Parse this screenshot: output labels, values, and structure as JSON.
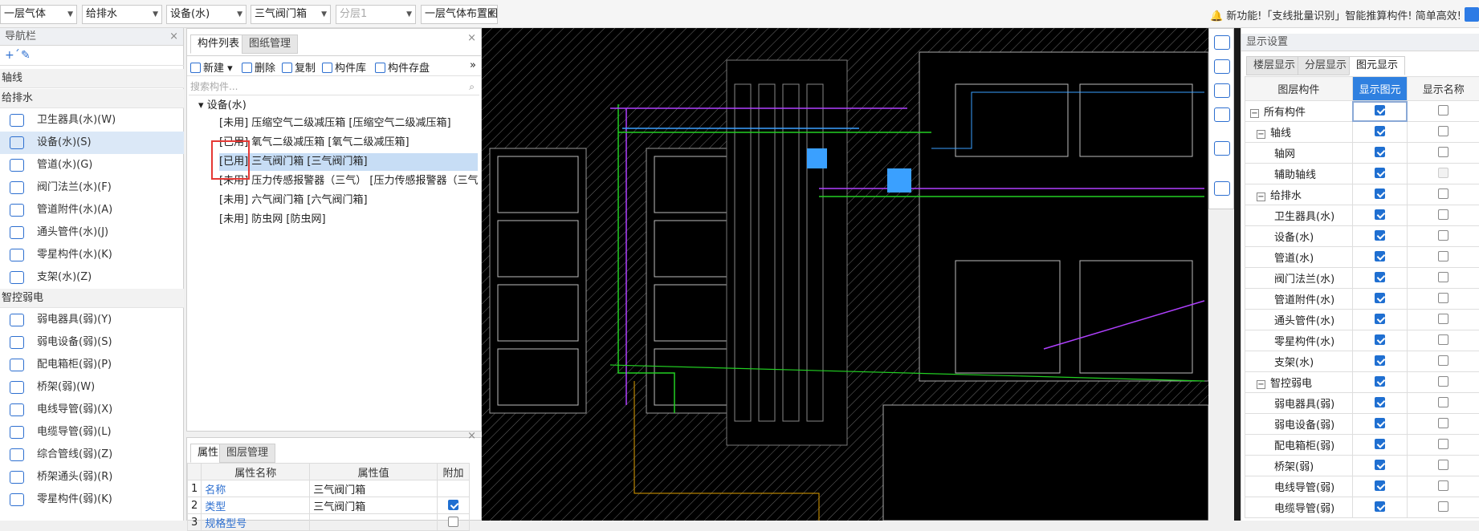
{
  "topbar": {
    "dropdowns": [
      "一层气体",
      "给排水",
      "设备(水)",
      "三气阀门箱",
      "分层1",
      "一层气体布置图"
    ],
    "notice_text": "新功能!「支线批量识别」智能推算构件! 简单高效!"
  },
  "nav": {
    "title": "导航栏",
    "groups": [
      {
        "label": "轴线",
        "items": []
      },
      {
        "label": "给排水",
        "items": [
          "卫生器具(水)(W)",
          "设备(水)(S)",
          "管道(水)(G)",
          "阀门法兰(水)(F)",
          "管道附件(水)(A)",
          "通头管件(水)(J)",
          "零星构件(水)(K)",
          "支架(水)(Z)"
        ]
      },
      {
        "label": "智控弱电",
        "items": [
          "弱电器具(弱)(Y)",
          "弱电设备(弱)(S)",
          "配电箱柜(弱)(P)",
          "桥架(弱)(W)",
          "电线导管(弱)(X)",
          "电缆导管(弱)(L)",
          "综合管线(弱)(Z)",
          "桥架通头(弱)(R)",
          "零星构件(弱)(K)"
        ]
      }
    ],
    "selected": "设备(水)(S)"
  },
  "components": {
    "tabs": [
      "构件列表",
      "图纸管理"
    ],
    "toolbar": [
      "新建",
      "删除",
      "复制",
      "构件库",
      "构件存盘"
    ],
    "search_placeholder": "搜索构件...",
    "root": "设备(水)",
    "items": [
      "[未用] 压缩空气二级减压箱 [压缩空气二级减压箱]",
      "[已用] 氧气二级减压箱 [氧气二级减压箱]",
      "[已用] 三气阀门箱 [三气阀门箱]",
      "[未用] 压力传感报警器（三气） [压力传感报警器（三气）]",
      "[未用] 六气阀门箱 [六气阀门箱]",
      "[未用] 防虫网 [防虫网]"
    ],
    "selected_index": 2
  },
  "properties": {
    "tabs": [
      "属性",
      "图层管理"
    ],
    "headers": [
      "属性名称",
      "属性值",
      "附加"
    ],
    "rows": [
      {
        "no": "1",
        "name": "名称",
        "value": "三气阀门箱",
        "extra": ""
      },
      {
        "no": "2",
        "name": "类型",
        "value": "三气阀门箱",
        "extra": "checked"
      },
      {
        "no": "3",
        "name": "规格型号",
        "value": "",
        "extra": "unchecked"
      }
    ]
  },
  "display": {
    "title": "显示设置",
    "tabs": [
      "楼层显示",
      "分层显示",
      "图元显示"
    ],
    "headers": [
      "图层构件",
      "显示图元",
      "显示名称"
    ],
    "rows": [
      {
        "label": "所有构件",
        "level": 0,
        "exp": "−",
        "show": true,
        "name": false
      },
      {
        "label": "轴线",
        "level": 1,
        "exp": "−",
        "show": true,
        "name": false
      },
      {
        "label": "轴网",
        "level": 2,
        "exp": "",
        "show": true,
        "name": false
      },
      {
        "label": "辅助轴线",
        "level": 2,
        "exp": "",
        "show": true,
        "name": "dis"
      },
      {
        "label": "给排水",
        "level": 1,
        "exp": "−",
        "show": true,
        "name": false
      },
      {
        "label": "卫生器具(水)",
        "level": 2,
        "exp": "",
        "show": true,
        "name": false
      },
      {
        "label": "设备(水)",
        "level": 2,
        "exp": "",
        "show": true,
        "name": false
      },
      {
        "label": "管道(水)",
        "level": 2,
        "exp": "",
        "show": true,
        "name": false
      },
      {
        "label": "阀门法兰(水)",
        "level": 2,
        "exp": "",
        "show": true,
        "name": false
      },
      {
        "label": "管道附件(水)",
        "level": 2,
        "exp": "",
        "show": true,
        "name": false
      },
      {
        "label": "通头管件(水)",
        "level": 2,
        "exp": "",
        "show": true,
        "name": false
      },
      {
        "label": "零星构件(水)",
        "level": 2,
        "exp": "",
        "show": true,
        "name": false
      },
      {
        "label": "支架(水)",
        "level": 2,
        "exp": "",
        "show": true,
        "name": false
      },
      {
        "label": "智控弱电",
        "level": 1,
        "exp": "−",
        "show": true,
        "name": false
      },
      {
        "label": "弱电器具(弱)",
        "level": 2,
        "exp": "",
        "show": true,
        "name": false
      },
      {
        "label": "弱电设备(弱)",
        "level": 2,
        "exp": "",
        "show": true,
        "name": false
      },
      {
        "label": "配电箱柜(弱)",
        "level": 2,
        "exp": "",
        "show": true,
        "name": false
      },
      {
        "label": "桥架(弱)",
        "level": 2,
        "exp": "",
        "show": true,
        "name": false
      },
      {
        "label": "电线导管(弱)",
        "level": 2,
        "exp": "",
        "show": true,
        "name": false
      },
      {
        "label": "电缆导管(弱)",
        "level": 2,
        "exp": "",
        "show": true,
        "name": false
      }
    ]
  },
  "colors": {
    "accent": "#2f80e0",
    "selected_row": "#c7ddf5",
    "highlight_box": "#e53935"
  }
}
